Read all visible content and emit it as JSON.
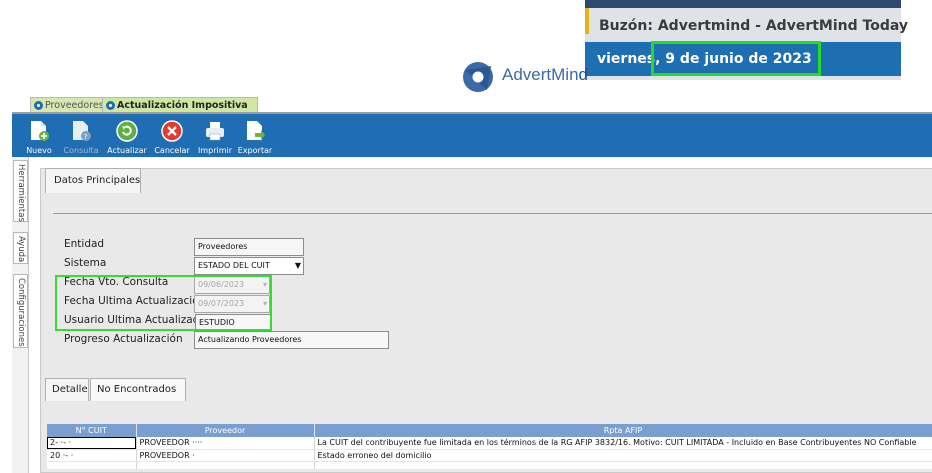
{
  "overlay": {
    "inbox_title": "Buzón: Advertmind - AdvertMind Today",
    "date": "viernes, 9 de junio de 2023"
  },
  "logo": {
    "text_main": "AdvertMin",
    "text_bold": "d"
  },
  "tabs": [
    {
      "label": "Proveedores"
    },
    {
      "label": "Actualización Impositiva"
    }
  ],
  "toolbar": {
    "buttons": [
      {
        "label": "Nuevo",
        "icon": "new-doc-icon"
      },
      {
        "label": "Consulta",
        "icon": "query-doc-icon",
        "disabled": true
      },
      {
        "label": "Actualizar",
        "icon": "refresh-icon"
      },
      {
        "label": "Cancelar",
        "icon": "cancel-icon"
      },
      {
        "label": "Imprimir",
        "icon": "printer-icon"
      },
      {
        "label": "Exportar",
        "icon": "export-icon"
      }
    ]
  },
  "side_tabs": [
    "Herramientas",
    "Ayuda",
    "Configuraciones"
  ],
  "form": {
    "tab_label": "Datos Principales",
    "entidad": {
      "label": "Entidad",
      "value": "Proveedores"
    },
    "sistema": {
      "label": "Sistema",
      "value": "ESTADO DEL CUIT"
    },
    "fecha_vto": {
      "label": "Fecha Vto. Consulta",
      "value": "09/06/2023"
    },
    "fecha_ult": {
      "label": "Fecha Ultima Actualización",
      "value": "09/07/2023"
    },
    "usuario": {
      "label": "Usuario Ultima Actualización",
      "value": "ESTUDIO"
    },
    "progreso": {
      "label": "Progreso Actualización",
      "value": "Actualizando Proveedores"
    }
  },
  "bottom_tabs": [
    "Detalle",
    "No Encontrados"
  ],
  "grid": {
    "headers": [
      "N° CUIT",
      "Proveedor",
      "Rpta AFIP"
    ],
    "rows": [
      {
        "cuit": "2- ·- ·",
        "proveedor": "PROVEEDOR ····",
        "rpta": "La CUIT del contribuyente fue limitada en los términos de la RG AFIP 3832/16. Motivo: CUIT LIMITADA - Incluido en Base Contribuyentes NO Confiable"
      },
      {
        "cuit": "20 ·- ·",
        "proveedor": "PROVEEDOR ·",
        "rpta": "Estado erroneo del domicilio"
      }
    ]
  },
  "colors": {
    "toolbar": "#1f6db3",
    "date_band": "#1e6fb1",
    "highlight": "#22dd22",
    "tab_green": "#cfe7a3",
    "grid_header": "#7b9ed0"
  }
}
